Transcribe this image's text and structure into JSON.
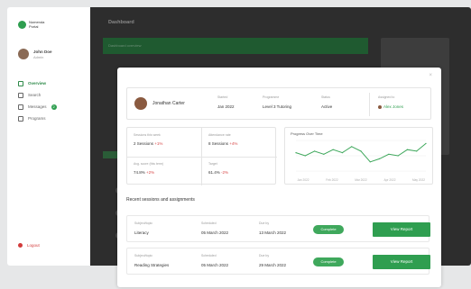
{
  "sidebar": {
    "logo_text": "Nomenda Portal",
    "profile": {
      "name": "John Doe",
      "role": "Admin"
    },
    "items": [
      {
        "label": "Overview",
        "icon": "grid-icon",
        "active": true
      },
      {
        "label": "Search",
        "icon": "search-icon"
      },
      {
        "label": "Messages",
        "icon": "message-icon",
        "badge": "2"
      },
      {
        "label": "Programs",
        "icon": "calendar-icon"
      }
    ],
    "logout_label": "Logout"
  },
  "main": {
    "page_title": "Dashboard",
    "banner_text": "Dashboard overview"
  },
  "modal": {
    "close": "×",
    "person": {
      "name": "Jonathan Carter"
    },
    "header_fields": [
      {
        "label": "Started",
        "value": "Jan 2022"
      },
      {
        "label": "Programme",
        "value": "Level 3 Tutoring"
      },
      {
        "label": "Status",
        "value": "Active"
      }
    ],
    "assigned": {
      "label": "Assigned to",
      "value": "Alex Jones"
    },
    "stats": [
      {
        "label": "Sessions this week",
        "value": "2 Sessions",
        "delta": "+1%"
      },
      {
        "label": "Attendance rate",
        "value": "8 Sessions",
        "delta": "+4%"
      },
      {
        "label": "Avg. score (this term)",
        "value": "74.8%",
        "delta": "+2%"
      },
      {
        "label": "Target",
        "value": "61.4%",
        "delta": "-2%"
      }
    ],
    "chart": {
      "title": "Progress Over Time"
    },
    "section_title": "Recent sessions and assignments",
    "rows": [
      {
        "col1_label": "Subject/topic",
        "col1": "Literacy",
        "col2_label": "Scheduled",
        "col2": "05 March 2022",
        "col3_label": "Due by",
        "col3": "13 March 2022",
        "badge": "Complete",
        "action": "View Report"
      },
      {
        "col1_label": "Subject/topic",
        "col1": "Reading Strategies",
        "col2_label": "Scheduled",
        "col2": "05 March 2022",
        "col3_label": "Due by",
        "col3": "29 March 2022",
        "badge": "Complete",
        "action": "View Report"
      }
    ]
  },
  "chart_data": {
    "type": "line",
    "title": "Progress Over Time",
    "categories": [
      "Jan 2022",
      "Feb 2022",
      "Mar 2022",
      "Apr 2022",
      "May 2022"
    ],
    "values": [
      62,
      60,
      63,
      61,
      64,
      62,
      66,
      63,
      56,
      58,
      61,
      60,
      64,
      63,
      68
    ]
  }
}
